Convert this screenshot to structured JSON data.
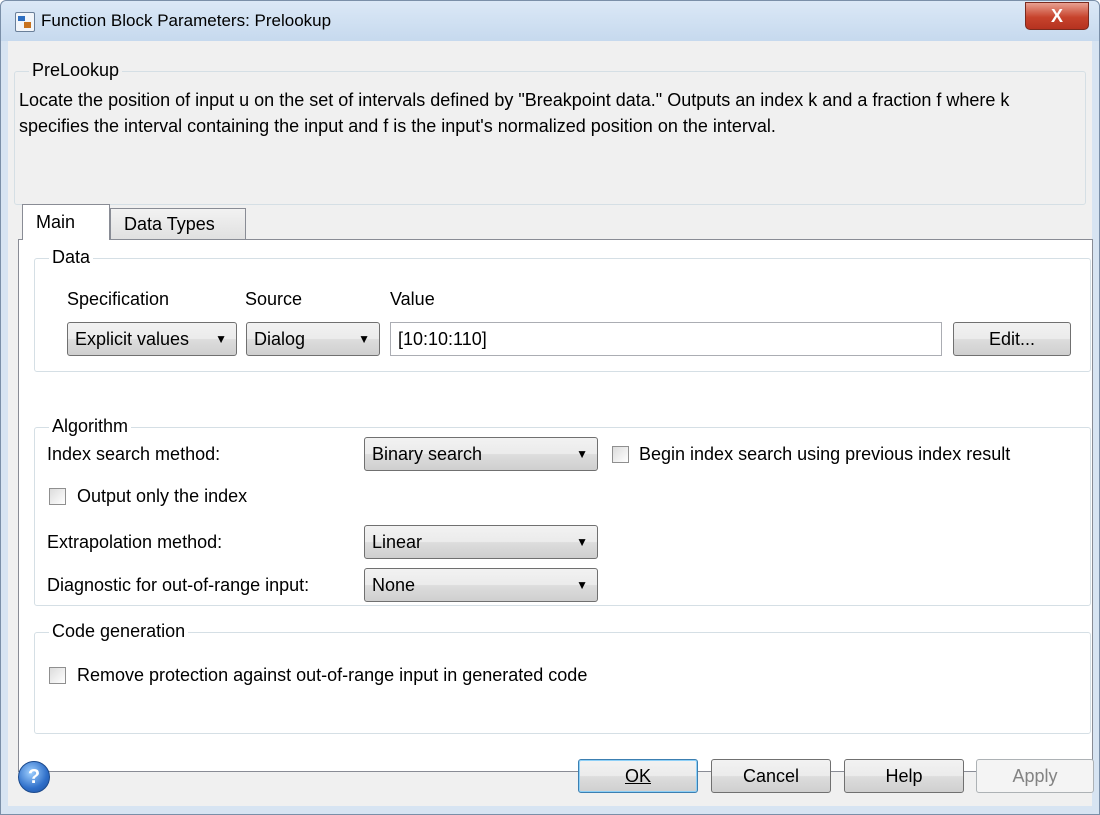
{
  "window": {
    "title": "Function Block Parameters: Prelookup",
    "close_label": "X"
  },
  "block": {
    "name": "PreLookup",
    "description": "Locate the position of input u on the set of intervals defined by \"Breakpoint data.\" Outputs an index k and a fraction f where k specifies the interval containing the input and f is the input's normalized position on the interval."
  },
  "tabs": [
    {
      "label": "Main",
      "active": true
    },
    {
      "label": "Data Types",
      "active": false
    }
  ],
  "data_group": {
    "title": "Data",
    "headers": {
      "specification": "Specification",
      "source": "Source",
      "value": "Value"
    },
    "specification_value": "Explicit values",
    "source_value": "Dialog",
    "value_text": "[10:10:110]",
    "edit_label": "Edit..."
  },
  "algorithm_group": {
    "title": "Algorithm",
    "index_search_label": "Index search method:",
    "index_search_value": "Binary search",
    "begin_index_label": "Begin index search using previous index result",
    "begin_index_checked": false,
    "output_only_index_label": "Output only the index",
    "output_only_index_checked": false,
    "extrapolation_label": "Extrapolation method:",
    "extrapolation_value": "Linear",
    "diagnostic_label": "Diagnostic for out-of-range input:",
    "diagnostic_value": "None"
  },
  "codegen_group": {
    "title": "Code generation",
    "remove_protection_label": "Remove protection against out-of-range input in generated code",
    "remove_protection_checked": false
  },
  "footer": {
    "help_icon": "question-icon",
    "ok_label": "OK",
    "cancel_label": "Cancel",
    "help_label": "Help",
    "apply_label": "Apply",
    "apply_enabled": false
  },
  "dropdown_arrow": "▼"
}
